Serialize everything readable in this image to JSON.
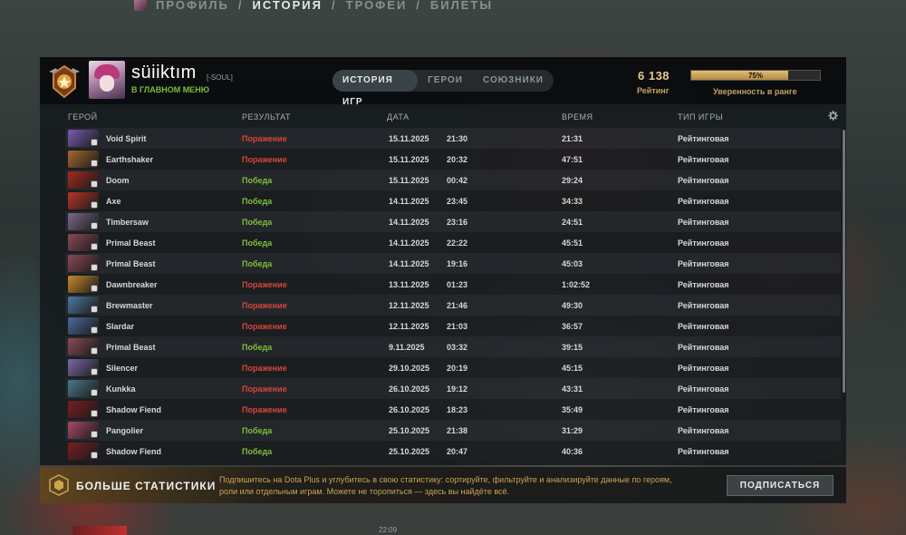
{
  "nav": {
    "items": [
      {
        "label": "ПРОФИЛЬ",
        "active": false
      },
      {
        "label": "ИСТОРИЯ",
        "active": true
      },
      {
        "label": "ТРОФЕИ",
        "active": false
      },
      {
        "label": "БИЛЕТЫ",
        "active": false
      }
    ],
    "separator": "/"
  },
  "player": {
    "name": "süiiktım",
    "tag": "[-SOUL]",
    "status": "В ГЛАВНОМ МЕНЮ"
  },
  "tabs": [
    {
      "label": "ИСТОРИЯ ИГР",
      "active": true
    },
    {
      "label": "ГЕРОИ",
      "active": false
    },
    {
      "label": "СОЮЗНИКИ",
      "active": false
    }
  ],
  "rating": {
    "value": "6 138",
    "label": "Рейтинг"
  },
  "confidence": {
    "value": 75,
    "text": "75%",
    "label": "Уверенность в ранге"
  },
  "columns": {
    "hero": "ГЕРОЙ",
    "result": "РЕЗУЛЬТАТ",
    "date": "ДАТА",
    "duration": "ВРЕМЯ",
    "type": "ТИП ИГРЫ"
  },
  "colors": {
    "win": "#7fbf3c",
    "loss": "#d9443a",
    "gold": "#c4a265"
  },
  "matches": [
    {
      "hero": "Void Spirit",
      "result": "Поражение",
      "win": false,
      "date": "15.11.2025",
      "time": "21:30",
      "duration": "21:31",
      "type": "Рейтинговая",
      "color": "#7a5bb5"
    },
    {
      "hero": "Earthshaker",
      "result": "Поражение",
      "win": false,
      "date": "15.11.2025",
      "time": "20:32",
      "duration": "47:51",
      "type": "Рейтинговая",
      "color": "#a56a2e"
    },
    {
      "hero": "Doom",
      "result": "Победа",
      "win": true,
      "date": "15.11.2025",
      "time": "00:42",
      "duration": "29:24",
      "type": "Рейтинговая",
      "color": "#a32a1e"
    },
    {
      "hero": "Axe",
      "result": "Победа",
      "win": true,
      "date": "14.11.2025",
      "time": "23:45",
      "duration": "34:33",
      "type": "Рейтинговая",
      "color": "#b53526"
    },
    {
      "hero": "Timbersaw",
      "result": "Победа",
      "win": true,
      "date": "14.11.2025",
      "time": "23:16",
      "duration": "24:51",
      "type": "Рейтинговая",
      "color": "#7b6a8a"
    },
    {
      "hero": "Primal Beast",
      "result": "Победа",
      "win": true,
      "date": "14.11.2025",
      "time": "22:22",
      "duration": "45:51",
      "type": "Рейтинговая",
      "color": "#8a4a56"
    },
    {
      "hero": "Primal Beast",
      "result": "Победа",
      "win": true,
      "date": "14.11.2025",
      "time": "19:16",
      "duration": "45:03",
      "type": "Рейтинговая",
      "color": "#8a4a56"
    },
    {
      "hero": "Dawnbreaker",
      "result": "Поражение",
      "win": false,
      "date": "13.11.2025",
      "time": "01:23",
      "duration": "1:02:52",
      "type": "Рейтинговая",
      "color": "#c78a2a"
    },
    {
      "hero": "Brewmaster",
      "result": "Поражение",
      "win": false,
      "date": "12.11.2025",
      "time": "21:46",
      "duration": "49:30",
      "type": "Рейтинговая",
      "color": "#4a7aa0"
    },
    {
      "hero": "Slardar",
      "result": "Поражение",
      "win": false,
      "date": "12.11.2025",
      "time": "21:03",
      "duration": "36:57",
      "type": "Рейтинговая",
      "color": "#4a6a9a"
    },
    {
      "hero": "Primal Beast",
      "result": "Победа",
      "win": true,
      "date": "9.11.2025",
      "time": "03:32",
      "duration": "39:15",
      "type": "Рейтинговая",
      "color": "#8a4a56"
    },
    {
      "hero": "Silencer",
      "result": "Поражение",
      "win": false,
      "date": "29.10.2025",
      "time": "20:19",
      "duration": "45:15",
      "type": "Рейтинговая",
      "color": "#7a6aa8"
    },
    {
      "hero": "Kunkka",
      "result": "Поражение",
      "win": false,
      "date": "26.10.2025",
      "time": "19:12",
      "duration": "43:31",
      "type": "Рейтинговая",
      "color": "#4a7a88"
    },
    {
      "hero": "Shadow Fiend",
      "result": "Поражение",
      "win": false,
      "date": "26.10.2025",
      "time": "18:23",
      "duration": "35:49",
      "type": "Рейтинговая",
      "color": "#7a1e22"
    },
    {
      "hero": "Pangolier",
      "result": "Победа",
      "win": true,
      "date": "25.10.2025",
      "time": "21:38",
      "duration": "31:29",
      "type": "Рейтинговая",
      "color": "#a84a6a"
    },
    {
      "hero": "Shadow Fiend",
      "result": "Победа",
      "win": true,
      "date": "25.10.2025",
      "time": "20:47",
      "duration": "40:36",
      "type": "Рейтинговая",
      "color": "#7a1e22"
    }
  ],
  "promo": {
    "title": "БОЛЬШЕ СТАТИСТИКИ",
    "text": "Подпишитесь на Dota Plus и углубитесь в свою статистику: сортируйте, фильтруйте и анализируйте данные по героям, роли или отдельным играм. Можете не торопиться — здесь вы найдёте всё.",
    "button": "ПОДПИСАТЬСЯ"
  },
  "clock": "22:09"
}
